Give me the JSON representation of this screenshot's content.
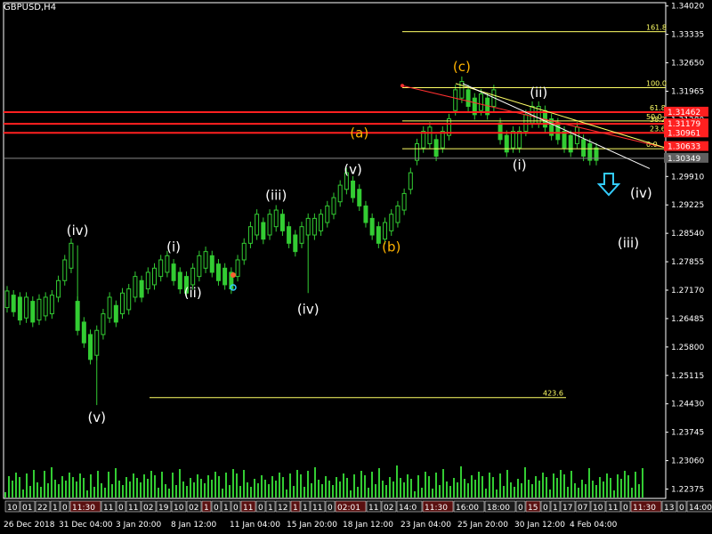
{
  "symbol": "GBPUSD,H4",
  "colors": {
    "background": "#000000",
    "candle": "#33cc33",
    "volume": "#33cc33",
    "fib_line": "#ffff66",
    "resistance": "#ff2020",
    "wave_white": "#ffffff",
    "wave_gold": "#ffb300",
    "arrow": "#33ccff"
  },
  "chart_data": {
    "type": "candlestick",
    "price_axis_labels": [
      "1.34020",
      "1.33335",
      "1.32650",
      "1.31965",
      "1.31280",
      "1.30595",
      "1.29910",
      "1.29225",
      "1.28540",
      "1.27855",
      "1.27170",
      "1.26485",
      "1.25800",
      "1.25115",
      "1.24430",
      "1.23745",
      "1.23060",
      "1.22375"
    ],
    "ylim": [
      1.2215,
      1.341
    ],
    "time_axis_labels": [
      "26 Dec 2018",
      "31 Dec 04:00",
      "3 Jan 20:00",
      "8 Jan 12:00",
      "11 Jan 04:00",
      "15 Jan 20:00",
      "18 Jan 12:00",
      "23 Jan 04:00",
      "25 Jan 20:00",
      "30 Jan 12:00",
      "4 Feb 04:00"
    ],
    "bottom_boxes": [
      "10",
      "01",
      "22",
      "1",
      "0",
      "11:30",
      "11",
      "0",
      "11",
      "02",
      "19",
      "10",
      "02",
      "1",
      "0",
      "1",
      "0",
      "11",
      "0",
      "1",
      "12",
      "1",
      "1",
      "11",
      "0",
      "02:01",
      "11",
      "02",
      "14:0",
      "11:30",
      "16:00",
      "18:00",
      "0",
      "15",
      "0",
      "1",
      "17",
      "07",
      "10",
      "11",
      "0",
      "11:30",
      "13",
      "0",
      "14:00"
    ],
    "close_path": [
      [
        1.2675,
        1.2715
      ],
      [
        1.2665,
        1.2705
      ],
      [
        1.2645,
        1.27
      ],
      [
        1.265,
        1.27
      ],
      [
        1.264,
        1.269
      ],
      [
        1.2645,
        1.2695
      ],
      [
        1.2655,
        1.27
      ],
      [
        1.266,
        1.2705
      ],
      [
        1.27,
        1.274
      ],
      [
        1.274,
        1.279
      ],
      [
        1.277,
        1.283
      ],
      [
        1.262,
        1.269
      ],
      [
        1.259,
        1.264
      ],
      [
        1.255,
        1.261
      ],
      [
        1.256,
        1.262
      ],
      [
        1.261,
        1.266
      ],
      [
        1.265,
        1.27
      ],
      [
        1.264,
        1.268
      ],
      [
        1.266,
        1.271
      ],
      [
        1.267,
        1.272
      ],
      [
        1.27,
        1.275
      ],
      [
        1.27,
        1.274
      ],
      [
        1.272,
        1.276
      ],
      [
        1.273,
        1.277
      ],
      [
        1.275,
        1.279
      ],
      [
        1.276,
        1.28
      ],
      [
        1.274,
        1.278
      ],
      [
        1.272,
        1.276
      ],
      [
        1.271,
        1.275
      ],
      [
        1.273,
        1.277
      ],
      [
        1.275,
        1.28
      ],
      [
        1.277,
        1.281
      ],
      [
        1.276,
        1.28
      ],
      [
        1.274,
        1.278
      ],
      [
        1.273,
        1.277
      ],
      [
        1.272,
        1.276
      ],
      [
        1.275,
        1.279
      ],
      [
        1.279,
        1.283
      ],
      [
        1.283,
        1.287
      ],
      [
        1.285,
        1.29
      ],
      [
        1.284,
        1.288
      ],
      [
        1.285,
        1.29
      ],
      [
        1.287,
        1.291
      ],
      [
        1.286,
        1.29
      ],
      [
        1.283,
        1.287
      ],
      [
        1.281,
        1.285
      ],
      [
        1.283,
        1.287
      ],
      [
        1.285,
        1.289
      ],
      [
        1.285,
        1.289
      ],
      [
        1.286,
        1.29
      ],
      [
        1.288,
        1.292
      ],
      [
        1.29,
        1.294
      ],
      [
        1.293,
        1.297
      ],
      [
        1.296,
        1.3
      ],
      [
        1.294,
        1.298
      ],
      [
        1.292,
        1.296
      ],
      [
        1.288,
        1.292
      ],
      [
        1.285,
        1.289
      ],
      [
        1.283,
        1.287
      ],
      [
        1.284,
        1.288
      ],
      [
        1.286,
        1.29
      ],
      [
        1.288,
        1.292
      ],
      [
        1.291,
        1.295
      ],
      [
        1.296,
        1.3
      ],
      [
        1.303,
        1.307
      ],
      [
        1.306,
        1.31
      ],
      [
        1.307,
        1.311
      ],
      [
        1.304,
        1.308
      ],
      [
        1.306,
        1.31
      ],
      [
        1.309,
        1.313
      ],
      [
        1.315,
        1.32
      ],
      [
        1.318,
        1.322
      ],
      [
        1.316,
        1.32
      ],
      [
        1.314,
        1.318
      ],
      [
        1.315,
        1.319
      ],
      [
        1.314,
        1.318
      ],
      [
        1.316,
        1.32
      ],
      [
        1.308,
        1.312
      ],
      [
        1.305,
        1.309
      ],
      [
        1.306,
        1.31
      ],
      [
        1.306,
        1.31
      ],
      [
        1.31,
        1.314
      ],
      [
        1.312,
        1.316
      ],
      [
        1.312,
        1.316
      ],
      [
        1.311,
        1.315
      ],
      [
        1.309,
        1.313
      ],
      [
        1.308,
        1.312
      ],
      [
        1.306,
        1.31
      ],
      [
        1.305,
        1.309
      ],
      [
        1.307,
        1.311
      ],
      [
        1.304,
        1.308
      ],
      [
        1.303,
        1.307
      ],
      [
        1.303,
        1.306
      ]
    ],
    "wicks": [
      {
        "bar": 14,
        "low": 1.244
      },
      {
        "bar": 47,
        "low": 1.271
      },
      {
        "bar": 11,
        "high": 1.2825
      }
    ],
    "horizontal_levels": [
      {
        "label": "161.8",
        "price": 1.334,
        "kind": "fib"
      },
      {
        "label": "100.0",
        "price": 1.3205,
        "kind": "fib"
      },
      {
        "label": "61.8",
        "price": 1.31462,
        "kind": "resistance"
      },
      {
        "label": "50.0",
        "price": 1.3125,
        "kind": "fib"
      },
      {
        "label": "38.2",
        "price": 1.31179,
        "kind": "resistance"
      },
      {
        "label": "23.6",
        "price": 1.30961,
        "kind": "resistance"
      },
      {
        "label": "0.0",
        "price": 1.3058,
        "kind": "fib"
      },
      {
        "label": "423.6",
        "price": 1.2458,
        "kind": "fib_low"
      }
    ],
    "price_tags": [
      {
        "text": "1.31462",
        "price": 1.31462,
        "style": "red"
      },
      {
        "text": "1.31179",
        "price": 1.31179,
        "style": "red"
      },
      {
        "text": "1.30961",
        "price": 1.30961,
        "style": "red"
      },
      {
        "text": "1.30633",
        "price": 1.30633,
        "style": "red"
      },
      {
        "text": "1.30349",
        "price": 1.30349,
        "style": "gray"
      }
    ],
    "wave_labels": [
      {
        "text": "(iv)",
        "bar": 11,
        "price": 1.285,
        "color": "white"
      },
      {
        "text": "(v)",
        "bar": 14,
        "price": 1.24,
        "color": "white"
      },
      {
        "text": "(i)",
        "bar": 26,
        "price": 1.281,
        "color": "white"
      },
      {
        "text": "(ii)",
        "bar": 29,
        "price": 1.27,
        "color": "white"
      },
      {
        "text": "(iii)",
        "bar": 42,
        "price": 1.2935,
        "color": "white"
      },
      {
        "text": "(iv)",
        "bar": 47,
        "price": 1.266,
        "color": "white"
      },
      {
        "text": "(v)",
        "bar": 54,
        "price": 1.2997,
        "color": "white"
      },
      {
        "text": "(a)",
        "bar": 55,
        "price": 1.3085,
        "color": "gold"
      },
      {
        "text": "(b)",
        "bar": 60,
        "price": 1.281,
        "color": "gold"
      },
      {
        "text": "(c)",
        "bar": 71,
        "price": 1.3245,
        "color": "gold"
      },
      {
        "text": "(ii)",
        "bar": 83,
        "price": 1.3183,
        "color": "white"
      },
      {
        "text": "(i)",
        "bar": 80,
        "price": 1.3008,
        "color": "white"
      },
      {
        "text": "(iv)",
        "bar": 99,
        "price": 1.294,
        "color": "white"
      },
      {
        "text": "(iii)",
        "bar": 97,
        "price": 1.282,
        "color": "white"
      }
    ]
  }
}
